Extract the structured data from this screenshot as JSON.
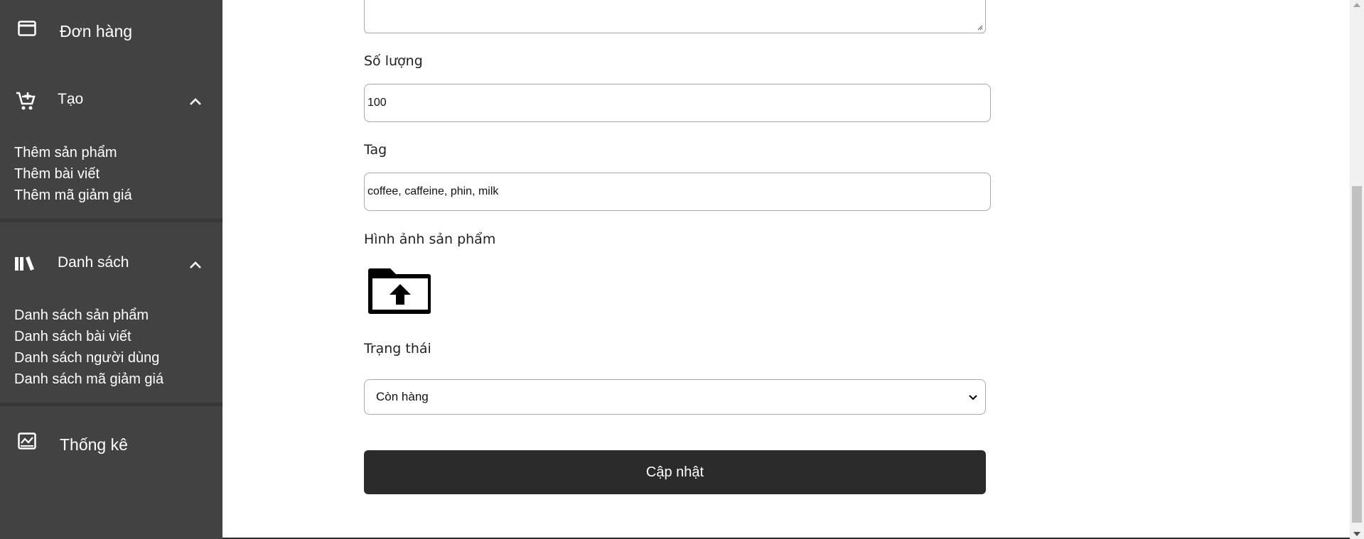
{
  "sidebar": {
    "orders": {
      "label": "Đơn hàng",
      "icon": "credit-card-icon"
    },
    "create": {
      "label": "Tạo",
      "icon": "add-cart-icon",
      "items": [
        "Thêm sản phẩm",
        "Thêm bài viết",
        "Thêm mã giảm giá"
      ]
    },
    "lists": {
      "label": "Danh sách",
      "icon": "library-books-icon",
      "items": [
        "Danh sách sản phẩm",
        "Danh sách bài viết",
        "Danh sách người dùng",
        "Danh sách mã giảm giá"
      ]
    },
    "stats": {
      "label": "Thống kê",
      "icon": "insert-chart-icon"
    }
  },
  "form": {
    "quantity": {
      "label": "Số lượng",
      "value": "100"
    },
    "tag": {
      "label": "Tag",
      "value": "coffee, caffeine, phin, milk"
    },
    "image": {
      "label": "Hình ảnh sản phẩm",
      "icon": "folder-upload-icon"
    },
    "status": {
      "label": "Trạng thái",
      "selected": "Còn hàng"
    },
    "submit_label": "Cập nhật"
  },
  "colors": {
    "sidebar_bg": "#424242",
    "button_bg": "#2b2b2b",
    "text": "#222222"
  }
}
